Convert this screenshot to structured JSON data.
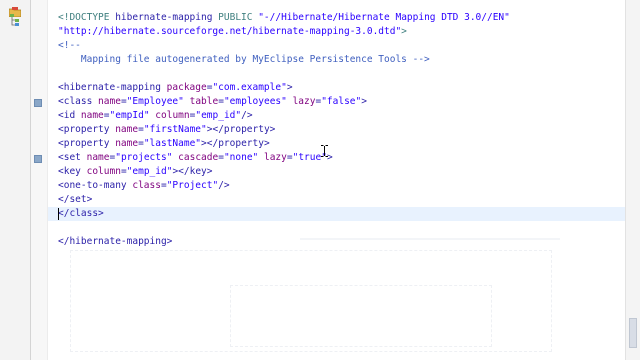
{
  "editor": {
    "lines": [
      {
        "parts": [
          [
            "t-pi",
            "<!DOCTYPE "
          ],
          [
            "t-tag",
            "hibernate-mapping "
          ],
          [
            "t-pi",
            "PUBLIC "
          ],
          [
            "t-val",
            "\"-//Hibernate/Hibernate Mapping DTD 3.0//EN\""
          ]
        ]
      },
      {
        "parts": [
          [
            "t-val",
            "\"http://hibernate.sourceforge.net/hibernate-mapping-3.0.dtd\""
          ],
          [
            "t-pi",
            ">"
          ]
        ]
      },
      {
        "parts": [
          [
            "t-comment",
            "<!--"
          ]
        ]
      },
      {
        "parts": [
          [
            "t-comment",
            "    Mapping file autogenerated by MyEclipse Persistence Tools -->"
          ]
        ]
      },
      {
        "parts": [
          [
            "t-tag",
            ""
          ]
        ]
      },
      {
        "parts": [
          [
            "t-tag",
            "<hibernate-mapping "
          ],
          [
            "t-attr",
            "package"
          ],
          [
            "t-tag",
            "="
          ],
          [
            "t-val",
            "\"com.example\""
          ],
          [
            "t-tag",
            ">"
          ]
        ]
      },
      {
        "parts": [
          [
            "t-tag",
            "<class "
          ],
          [
            "t-attr",
            "name"
          ],
          [
            "t-tag",
            "="
          ],
          [
            "t-val",
            "\"Employee\" "
          ],
          [
            "t-attr",
            "table"
          ],
          [
            "t-tag",
            "="
          ],
          [
            "t-val",
            "\"employees\" "
          ],
          [
            "t-attr",
            "lazy"
          ],
          [
            "t-tag",
            "="
          ],
          [
            "t-val",
            "\"false\""
          ],
          [
            "t-tag",
            ">"
          ]
        ]
      },
      {
        "parts": [
          [
            "t-tag",
            "<id "
          ],
          [
            "t-attr",
            "name"
          ],
          [
            "t-tag",
            "="
          ],
          [
            "t-val",
            "\"empId\" "
          ],
          [
            "t-attr",
            "column"
          ],
          [
            "t-tag",
            "="
          ],
          [
            "t-val",
            "\"emp_id\""
          ],
          [
            "t-tag",
            "/>"
          ]
        ]
      },
      {
        "parts": [
          [
            "t-tag",
            "<property "
          ],
          [
            "t-attr",
            "name"
          ],
          [
            "t-tag",
            "="
          ],
          [
            "t-val",
            "\"firstName\""
          ],
          [
            "t-tag",
            "></property>"
          ]
        ]
      },
      {
        "parts": [
          [
            "t-tag",
            "<property "
          ],
          [
            "t-attr",
            "name"
          ],
          [
            "t-tag",
            "="
          ],
          [
            "t-val",
            "\"lastName\""
          ],
          [
            "t-tag",
            "></property>"
          ]
        ]
      },
      {
        "parts": [
          [
            "t-tag",
            "<set "
          ],
          [
            "t-attr",
            "name"
          ],
          [
            "t-tag",
            "="
          ],
          [
            "t-val",
            "\"projects\" "
          ],
          [
            "t-attr",
            "cascade"
          ],
          [
            "t-tag",
            "="
          ],
          [
            "t-val",
            "\"none\" "
          ],
          [
            "t-attr",
            "lazy"
          ],
          [
            "t-tag",
            "="
          ],
          [
            "t-val",
            "\"true\""
          ],
          [
            "t-tag",
            ">"
          ]
        ]
      },
      {
        "parts": [
          [
            "t-tag",
            "<key "
          ],
          [
            "t-attr",
            "column"
          ],
          [
            "t-tag",
            "="
          ],
          [
            "t-val",
            "\"emp_id\""
          ],
          [
            "t-tag",
            "></key>"
          ]
        ]
      },
      {
        "parts": [
          [
            "t-tag",
            "<one-to-many "
          ],
          [
            "t-attr",
            "class"
          ],
          [
            "t-tag",
            "="
          ],
          [
            "t-val",
            "\"Project\""
          ],
          [
            "t-tag",
            "/>"
          ]
        ]
      },
      {
        "parts": [
          [
            "t-tag",
            "</set>"
          ]
        ]
      },
      {
        "parts": [
          [
            "t-tag",
            "</class>"
          ]
        ]
      },
      {
        "parts": [
          [
            "t-tag",
            ""
          ]
        ]
      },
      {
        "parts": [
          [
            "t-tag",
            "</hibernate-mapping>"
          ]
        ]
      }
    ],
    "fold_lines": [
      6,
      10
    ]
  },
  "icons": {
    "left_strip": [
      "folder-icon",
      "tree-icon"
    ],
    "cursor": "ibeam-cursor-icon"
  }
}
